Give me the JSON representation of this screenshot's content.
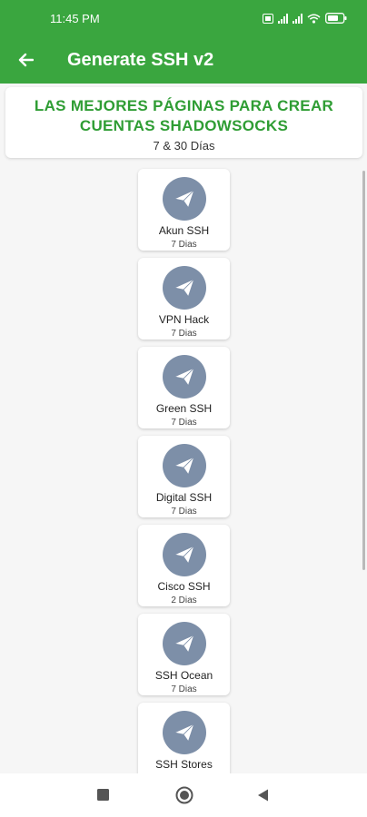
{
  "status_bar": {
    "time": "11:45 PM",
    "battery": "battery-icon",
    "wifi": "wifi-icon"
  },
  "toolbar": {
    "title": "Generate SSH v2",
    "back_icon": "arrow-back-icon"
  },
  "header": {
    "title_line1": "LAS MEJORES PÁGINAS PARA CREAR",
    "title_line2": "CUENTAS SHADOWSOCKS",
    "subtitle": "7 & 30 Días"
  },
  "items": [
    {
      "name": "Akun SSH",
      "days": "7 Dias"
    },
    {
      "name": "VPN Hack",
      "days": "7 Dias"
    },
    {
      "name": "Green SSH",
      "days": "7 Dias"
    },
    {
      "name": "Digital SSH",
      "days": "7 Dias"
    },
    {
      "name": "Cisco SSH",
      "days": "2 Dias"
    },
    {
      "name": "SSH Ocean",
      "days": "7 Dias"
    },
    {
      "name": "SSH Stores",
      "days": ""
    }
  ],
  "nav": {
    "recents": "recents-square-icon",
    "home": "home-circle-icon",
    "back": "back-triangle-icon"
  },
  "colors": {
    "primary": "#3aa63f",
    "title_green": "#2f9d34",
    "icon_bg": "#7d8fa8"
  }
}
